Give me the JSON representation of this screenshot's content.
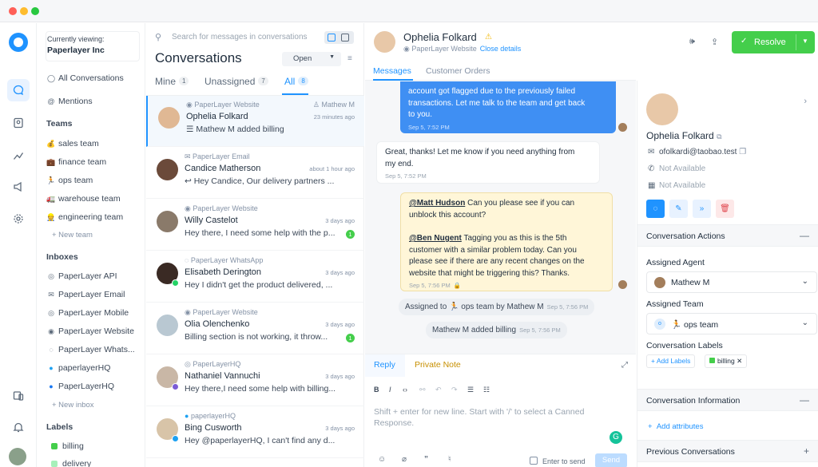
{
  "sidebar": {
    "viewing_label": "Currently viewing:",
    "org": "Paperlayer Inc",
    "all_conversations": "All Conversations",
    "mentions": "Mentions",
    "teams_head": "Teams",
    "teams": [
      "sales team",
      "finance team",
      "ops team",
      "warehouse team",
      "engineering team"
    ],
    "new_team": "+ New team",
    "inboxes_head": "Inboxes",
    "inboxes": [
      "PaperLayer API",
      "PaperLayer Email",
      "PaperLayer Mobile",
      "PaperLayer Website",
      "PaperLayer Whats...",
      "paperlayerHQ",
      "PaperLayerHQ"
    ],
    "new_inbox": "+ New inbox",
    "labels_head": "Labels",
    "labels": [
      "billing",
      "delivery"
    ]
  },
  "convlist": {
    "search_placeholder": "Search for messages in conversations",
    "title": "Conversations",
    "status": "Open",
    "tabs": [
      {
        "label": "Mine",
        "count": "1"
      },
      {
        "label": "Unassigned",
        "count": "7"
      },
      {
        "label": "All",
        "count": "8"
      }
    ],
    "items": [
      {
        "channel": "PaperLayer Website",
        "name": "Ophelia Folkard",
        "msg": "Mathew M added billing",
        "time": "23 minutes ago",
        "agent": "Mathew M",
        "unread": ""
      },
      {
        "channel": "PaperLayer Email",
        "name": "Candice Matherson",
        "msg": "Hey Candice, Our delivery partners ...",
        "time": "about 1 hour ago",
        "agent": "",
        "unread": ""
      },
      {
        "channel": "PaperLayer Website",
        "name": "Willy Castelot",
        "msg": "Hey there, I need some help with the p...",
        "time": "3 days ago",
        "agent": "",
        "unread": "1"
      },
      {
        "channel": "PaperLayer WhatsApp",
        "name": "Elisabeth Derington",
        "msg": "Hey I didn't get the product delivered, ...",
        "time": "3 days ago",
        "agent": "",
        "unread": ""
      },
      {
        "channel": "PaperLayer Website",
        "name": "Olia Olenchenko",
        "msg": "Billing section is not working, it throw...",
        "time": "3 days ago",
        "agent": "",
        "unread": "1"
      },
      {
        "channel": "PaperLayerHQ",
        "name": "Nathaniel Vannuchi",
        "msg": "Hey there,I need some help with billing...",
        "time": "3 days ago",
        "agent": "",
        "unread": ""
      },
      {
        "channel": "paperlayerHQ",
        "name": "Bing Cusworth",
        "msg": "Hey @paperlayerHQ, I can't find any d...",
        "time": "3 days ago",
        "agent": "",
        "unread": ""
      }
    ]
  },
  "chat": {
    "name": "Ophelia Folkard",
    "inbox": "PaperLayer Website",
    "close_details": "Close details",
    "tabs": [
      "Messages",
      "Customer Orders"
    ],
    "outgoing": {
      "line1": "account got flagged due to the previously failed",
      "line2": "transactions. Let me talk to the team and get back",
      "line3": "to you.",
      "time": "Sep 5, 7:52 PM"
    },
    "incoming": {
      "line1": "Great, thanks! Let me know if you need anything from",
      "line2": "my end.",
      "time": "Sep 5, 7:52 PM"
    },
    "note": {
      "mention1": "@Matt Hudson",
      "p1a": " Can you please see if you can",
      "p1b": "unblock this account?",
      "mention2": "@Ben Nugent",
      "p2a": " Tagging you as this is the 5th",
      "p2b": "customer with a similar problem today. Can you",
      "p2c": "please see if there are any recent changes on the",
      "p2d": "website that might be triggering this? Thanks.",
      "time": "Sep 5, 7:56 PM"
    },
    "activity1": {
      "text": "Assigned to 🏃 ops team by Mathew M",
      "time": "Sep 5, 7:56 PM"
    },
    "activity2": {
      "text": "Mathew M added billing",
      "time": "Sep 5, 7:56 PM"
    },
    "composer": {
      "reply": "Reply",
      "private_note": "Private Note",
      "placeholder_line1": "Shift + enter for new line. Start with '/' to select a Canned",
      "placeholder_line2": "Response.",
      "enter_to_send": "Enter to send",
      "send": "Send"
    }
  },
  "header": {
    "resolve": "Resolve"
  },
  "contact": {
    "name": "Ophelia Folkard",
    "email": "ofolkardi@taobao.test",
    "phone": "Not Available",
    "company": "Not Available",
    "actions_head": "Conversation Actions",
    "assigned_agent_lbl": "Assigned Agent",
    "assigned_agent": "Mathew M",
    "assigned_team_lbl": "Assigned Team",
    "assigned_team": "🏃 ops team",
    "labels_lbl": "Conversation Labels",
    "add_labels": "+ Add Labels",
    "label": "billing",
    "info_head": "Conversation Information",
    "add_attributes": "Add attributes",
    "previous_head": "Previous Conversations"
  },
  "colors": {
    "accent": "#1f93ff",
    "resolve": "#44ce4b",
    "billing": "#44ce4b",
    "delivery": "#a7f0ba"
  }
}
